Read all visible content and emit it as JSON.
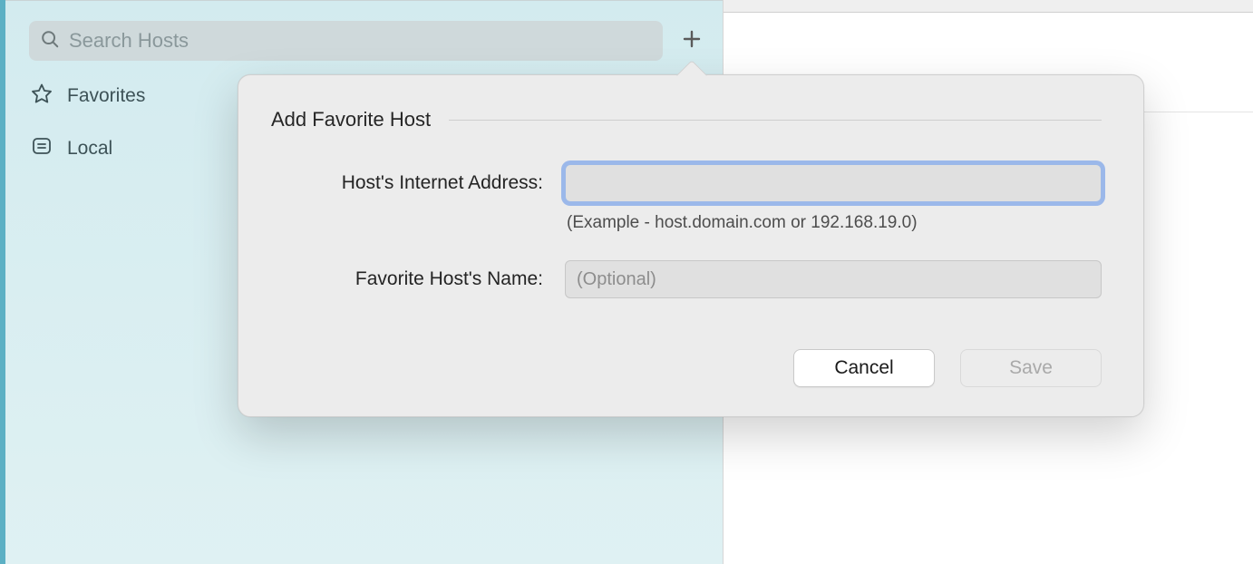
{
  "sidebar": {
    "search_placeholder": "Search Hosts",
    "items": [
      {
        "label": "Favorites"
      },
      {
        "label": "Local"
      }
    ]
  },
  "popover": {
    "title": "Add Favorite Host",
    "address_label": "Host's Internet Address:",
    "address_value": "",
    "address_hint": "(Example - host.domain.com or 192.168.19.0)",
    "name_label": "Favorite Host's Name:",
    "name_value": "",
    "name_placeholder": "(Optional)",
    "cancel_label": "Cancel",
    "save_label": "Save"
  }
}
